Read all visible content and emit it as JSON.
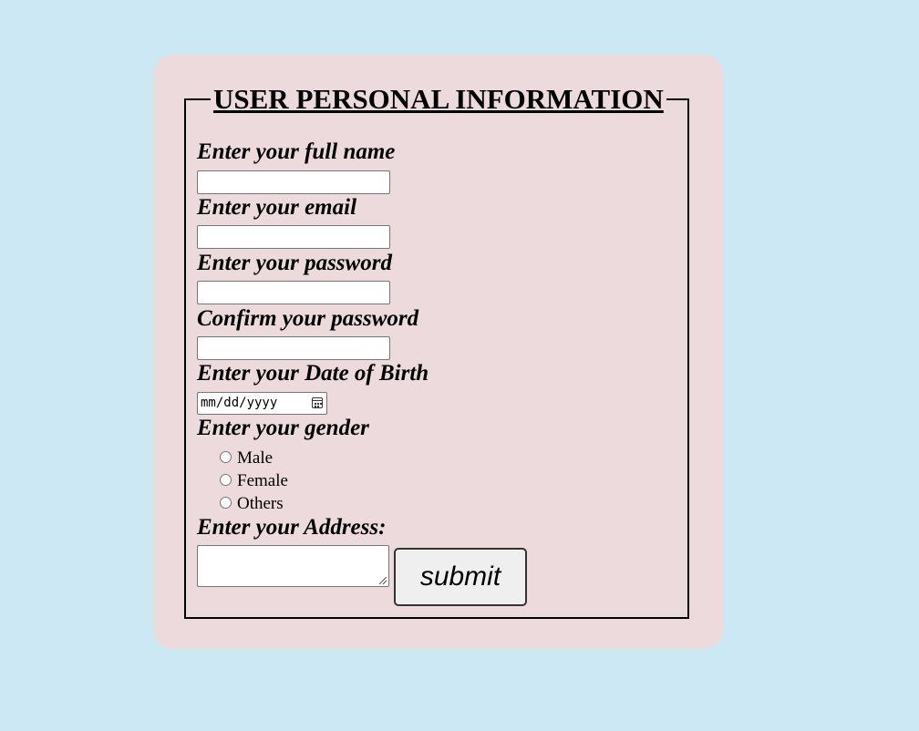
{
  "form": {
    "title": "USER PERSONAL INFORMATION",
    "fields": {
      "full_name_label": "Enter your full name",
      "email_label": "Enter your email",
      "password_label": "Enter your password",
      "confirm_password_label": "Confirm your password",
      "dob_label": "Enter your Date of Birth",
      "dob_placeholder": "mm/dd/yyyy",
      "gender_label": "Enter your gender",
      "gender_options": [
        "Male",
        "Female",
        "Others"
      ],
      "address_label": "Enter your Address:"
    },
    "submit_label": "submit"
  },
  "colors": {
    "background": "#cbe8f4",
    "card": "#eddadc"
  },
  "icons": {
    "date_picker": "calendar-icon",
    "textarea_resize": "resize-grip-icon"
  }
}
